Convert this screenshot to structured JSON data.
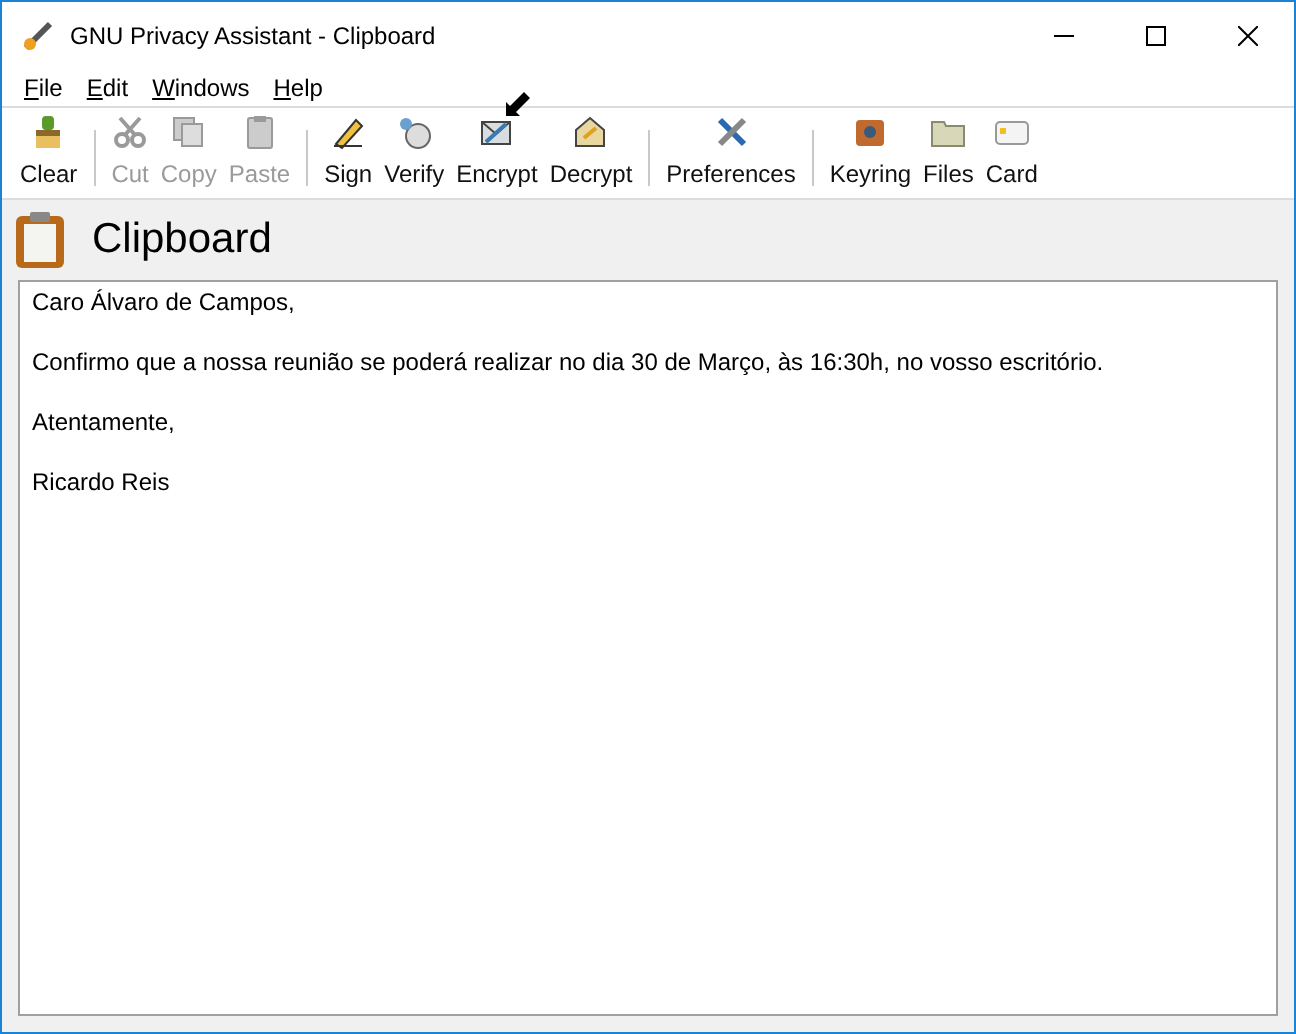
{
  "window": {
    "title": "GNU Privacy Assistant - Clipboard"
  },
  "menu": [
    {
      "label": "File"
    },
    {
      "label": "Edit"
    },
    {
      "label": "Windows"
    },
    {
      "label": "Help"
    }
  ],
  "toolbar": [
    {
      "kind": "button",
      "label": "Clear",
      "disabled": false,
      "hovered": false
    },
    {
      "kind": "separator"
    },
    {
      "kind": "button",
      "label": "Cut",
      "disabled": true,
      "hovered": false
    },
    {
      "kind": "button",
      "label": "Copy",
      "disabled": true,
      "hovered": false
    },
    {
      "kind": "button",
      "label": "Paste",
      "disabled": true,
      "hovered": false
    },
    {
      "kind": "separator"
    },
    {
      "kind": "button",
      "label": "Sign",
      "disabled": false,
      "hovered": false
    },
    {
      "kind": "button",
      "label": "Verify",
      "disabled": false,
      "hovered": false
    },
    {
      "kind": "button",
      "label": "Encrypt",
      "disabled": false,
      "hovered": true
    },
    {
      "kind": "button",
      "label": "Decrypt",
      "disabled": false,
      "hovered": false
    },
    {
      "kind": "separator"
    },
    {
      "kind": "button",
      "label": "Preferences",
      "disabled": false,
      "hovered": false
    },
    {
      "kind": "separator"
    },
    {
      "kind": "button",
      "label": "Keyring",
      "disabled": false,
      "hovered": false
    },
    {
      "kind": "button",
      "label": "Files",
      "disabled": false,
      "hovered": false
    },
    {
      "kind": "button",
      "label": "Card",
      "disabled": false,
      "hovered": false
    }
  ],
  "header": {
    "title": "Clipboard"
  },
  "editor": {
    "paragraphs": [
      "Caro Álvaro de Campos,",
      "Confirmo que a nossa reunião se poderá realizar no dia 30 de Março, às 16:30h, no vosso escritório.",
      "Atentamente,",
      "Ricardo Reis"
    ]
  }
}
